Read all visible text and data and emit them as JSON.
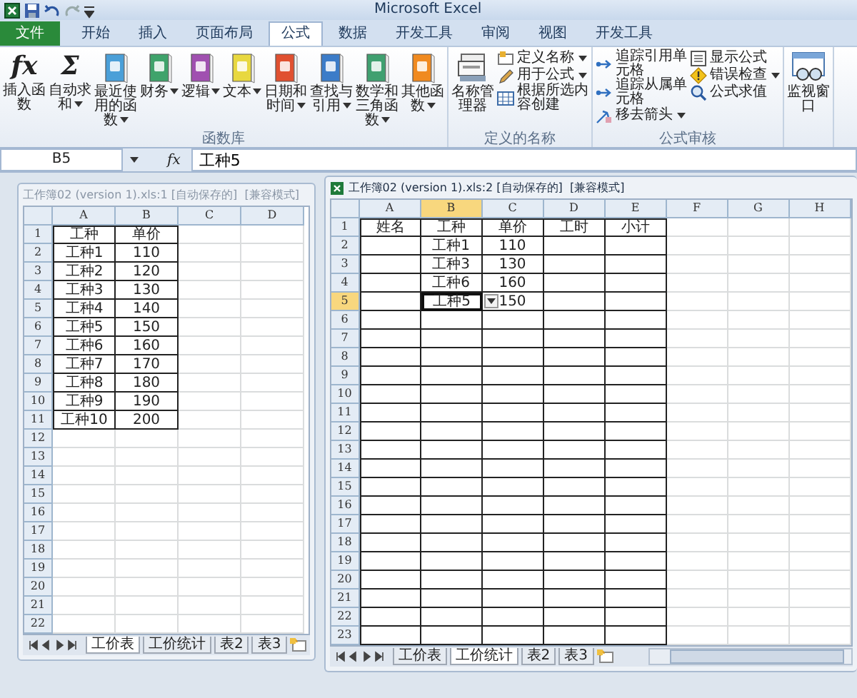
{
  "title_bar": {
    "title": "Microsoft Excel"
  },
  "ribbon_tabs": [
    {
      "label": "文件",
      "selected": false,
      "kind": "file"
    },
    {
      "label": "开始",
      "selected": false,
      "kind": "tab"
    },
    {
      "label": "插入",
      "selected": false,
      "kind": "tab"
    },
    {
      "label": "页面布局",
      "selected": false,
      "kind": "tab"
    },
    {
      "label": "公式",
      "selected": true,
      "kind": "tab"
    },
    {
      "label": "数据",
      "selected": false,
      "kind": "tab"
    },
    {
      "label": "开发工具",
      "selected": false,
      "kind": "tab"
    },
    {
      "label": "审阅",
      "selected": false,
      "kind": "tab"
    },
    {
      "label": "视图",
      "selected": false,
      "kind": "tab"
    },
    {
      "label": "开发工具",
      "selected": false,
      "kind": "tab"
    }
  ],
  "ribbon_groups": [
    {
      "label": "函数库",
      "buttons": [
        {
          "kind": "large",
          "label": "插入函数",
          "glyph": "fx",
          "dropdown": false
        },
        {
          "kind": "large",
          "label": "自动求和",
          "glyph": "Σ",
          "dropdown": true
        },
        {
          "kind": "large",
          "label": "最近使用的函数",
          "color": "#4a9fd8",
          "dropdown": true
        },
        {
          "kind": "large",
          "label": "财务",
          "color": "#3fa36b",
          "dropdown": true
        },
        {
          "kind": "large",
          "label": "逻辑",
          "color": "#a050b0",
          "dropdown": true
        },
        {
          "kind": "large",
          "label": "文本",
          "color": "#e8d840",
          "dropdown": true
        },
        {
          "kind": "large",
          "label": "日期和时间",
          "color": "#e05030",
          "dropdown": true
        },
        {
          "kind": "large",
          "label": "查找与引用",
          "color": "#3c7cc8",
          "dropdown": true
        },
        {
          "kind": "large",
          "label": "数学和三角函数",
          "color": "#40a070",
          "dropdown": true
        },
        {
          "kind": "large",
          "label": "其他函数",
          "color": "#f08a20",
          "dropdown": true
        }
      ]
    },
    {
      "label": "定义的名称",
      "buttons": [
        {
          "kind": "large",
          "label": "名称管理器",
          "dropdown": false
        },
        {
          "kind": "small",
          "label": "定义名称",
          "dropdown": true
        },
        {
          "kind": "small",
          "label": "用于公式",
          "dropdown": true
        },
        {
          "kind": "small",
          "label": "根据所选内容创建",
          "dropdown": false
        }
      ]
    },
    {
      "label": "公式审核",
      "buttons": [
        {
          "kind": "small",
          "label": "追踪引用单元格",
          "dropdown": false
        },
        {
          "kind": "small",
          "label": "追踪从属单元格",
          "dropdown": false
        },
        {
          "kind": "small",
          "label": "移去箭头",
          "dropdown": true
        },
        {
          "kind": "small",
          "label": "显示公式",
          "dropdown": false
        },
        {
          "kind": "small",
          "label": "错误检查",
          "dropdown": true
        },
        {
          "kind": "small",
          "label": "公式求值",
          "dropdown": false
        }
      ]
    },
    {
      "buttons": [
        {
          "kind": "large",
          "label": "监视窗口",
          "dropdown": false
        }
      ]
    }
  ],
  "formula_bar": {
    "name_box": "B5",
    "fx": "fx",
    "value": "工种5"
  },
  "windows": [
    {
      "title": "工作簿02 (version 1).xls:1 [自动保存的]  [兼容模式]",
      "active": false,
      "sheet": {
        "columns": [
          {
            "label": "A",
            "selected": false,
            "bordered": true
          },
          {
            "label": "B",
            "selected": false,
            "bordered": true
          },
          {
            "label": "C",
            "selected": false,
            "bordered": false
          },
          {
            "label": "D",
            "selected": false,
            "bordered": false
          }
        ],
        "rows": [
          {
            "label": "1",
            "selected": false,
            "bordered": true,
            "cells": {
              "A": "工种",
              "B": "单价"
            }
          },
          {
            "label": "2",
            "selected": false,
            "bordered": true,
            "cells": {
              "A": "工种1",
              "B": "110"
            }
          },
          {
            "label": "3",
            "selected": false,
            "bordered": true,
            "cells": {
              "A": "工种2",
              "B": "120"
            }
          },
          {
            "label": "4",
            "selected": false,
            "bordered": true,
            "cells": {
              "A": "工种3",
              "B": "130"
            }
          },
          {
            "label": "5",
            "selected": false,
            "bordered": true,
            "cells": {
              "A": "工种4",
              "B": "140"
            }
          },
          {
            "label": "6",
            "selected": false,
            "bordered": true,
            "cells": {
              "A": "工种5",
              "B": "150"
            }
          },
          {
            "label": "7",
            "selected": false,
            "bordered": true,
            "cells": {
              "A": "工种6",
              "B": "160"
            }
          },
          {
            "label": "8",
            "selected": false,
            "bordered": true,
            "cells": {
              "A": "工种7",
              "B": "170"
            }
          },
          {
            "label": "9",
            "selected": false,
            "bordered": true,
            "cells": {
              "A": "工种8",
              "B": "180"
            }
          },
          {
            "label": "10",
            "selected": false,
            "bordered": true,
            "cells": {
              "A": "工种9",
              "B": "190"
            }
          },
          {
            "label": "11",
            "selected": false,
            "bordered": true,
            "cells": {
              "A": "工种10",
              "B": "200"
            }
          },
          {
            "label": "12",
            "selected": false,
            "bordered": false
          },
          {
            "label": "13",
            "selected": false,
            "bordered": false
          },
          {
            "label": "14",
            "selected": false,
            "bordered": false
          },
          {
            "label": "15",
            "selected": false,
            "bordered": false
          },
          {
            "label": "16",
            "selected": false,
            "bordered": false
          },
          {
            "label": "17",
            "selected": false,
            "bordered": false
          },
          {
            "label": "18",
            "selected": false,
            "bordered": false
          },
          {
            "label": "19",
            "selected": false,
            "bordered": false
          },
          {
            "label": "20",
            "selected": false,
            "bordered": false
          },
          {
            "label": "21",
            "selected": false,
            "bordered": false
          },
          {
            "label": "22",
            "selected": false,
            "bordered": false
          }
        ]
      },
      "sheet_tabs": [
        {
          "label": "工价表",
          "selected": true
        },
        {
          "label": "工价统计",
          "selected": false
        },
        {
          "label": "表2",
          "selected": false
        },
        {
          "label": "表3",
          "selected": false
        }
      ]
    },
    {
      "title": "工作簿02 (version 1).xls:2 [自动保存的]  [兼容模式]",
      "active": true,
      "sheet": {
        "cell_dropdown": true,
        "columns": [
          {
            "label": "A",
            "selected": false,
            "bordered": true
          },
          {
            "label": "B",
            "selected": true,
            "bordered": true
          },
          {
            "label": "C",
            "selected": false,
            "bordered": true
          },
          {
            "label": "D",
            "selected": false,
            "bordered": true
          },
          {
            "label": "E",
            "selected": false,
            "bordered": true
          },
          {
            "label": "F",
            "selected": false,
            "bordered": false
          },
          {
            "label": "G",
            "selected": false,
            "bordered": false
          },
          {
            "label": "H",
            "selected": false,
            "bordered": false
          }
        ],
        "rows": [
          {
            "label": "1",
            "selected": false,
            "bordered": true,
            "cells": {
              "A": "姓名",
              "B": "工种",
              "C": "单价",
              "D": "工时",
              "E": "小计"
            }
          },
          {
            "label": "2",
            "selected": false,
            "bordered": true,
            "cells": {
              "B": "工种1",
              "C": "110"
            }
          },
          {
            "label": "3",
            "selected": false,
            "bordered": true,
            "cells": {
              "B": "工种3",
              "C": "130"
            }
          },
          {
            "label": "4",
            "selected": false,
            "bordered": true,
            "cells": {
              "B": "工种6",
              "C": "160"
            }
          },
          {
            "label": "5",
            "selected": true,
            "bordered": true,
            "cells": {
              "B": "工种5",
              "C": "150"
            }
          },
          {
            "label": "6",
            "selected": false,
            "bordered": true
          },
          {
            "label": "7",
            "selected": false,
            "bordered": true
          },
          {
            "label": "8",
            "selected": false,
            "bordered": true
          },
          {
            "label": "9",
            "selected": false,
            "bordered": true
          },
          {
            "label": "10",
            "selected": false,
            "bordered": true
          },
          {
            "label": "11",
            "selected": false,
            "bordered": true
          },
          {
            "label": "12",
            "selected": false,
            "bordered": true
          },
          {
            "label": "13",
            "selected": false,
            "bordered": true
          },
          {
            "label": "14",
            "selected": false,
            "bordered": true
          },
          {
            "label": "15",
            "selected": false,
            "bordered": true
          },
          {
            "label": "16",
            "selected": false,
            "bordered": true
          },
          {
            "label": "17",
            "selected": false,
            "bordered": true
          },
          {
            "label": "18",
            "selected": false,
            "bordered": true
          },
          {
            "label": "19",
            "selected": false,
            "bordered": true
          },
          {
            "label": "20",
            "selected": false,
            "bordered": true
          },
          {
            "label": "21",
            "selected": false,
            "bordered": true
          },
          {
            "label": "22",
            "selected": false,
            "bordered": true
          },
          {
            "label": "23",
            "selected": false,
            "bordered": true
          }
        ]
      },
      "sheet_tabs": [
        {
          "label": "工价表",
          "selected": false
        },
        {
          "label": "工价统计",
          "selected": true
        },
        {
          "label": "表2",
          "selected": false
        },
        {
          "label": "表3",
          "selected": false
        }
      ],
      "scrollbar": true
    }
  ]
}
